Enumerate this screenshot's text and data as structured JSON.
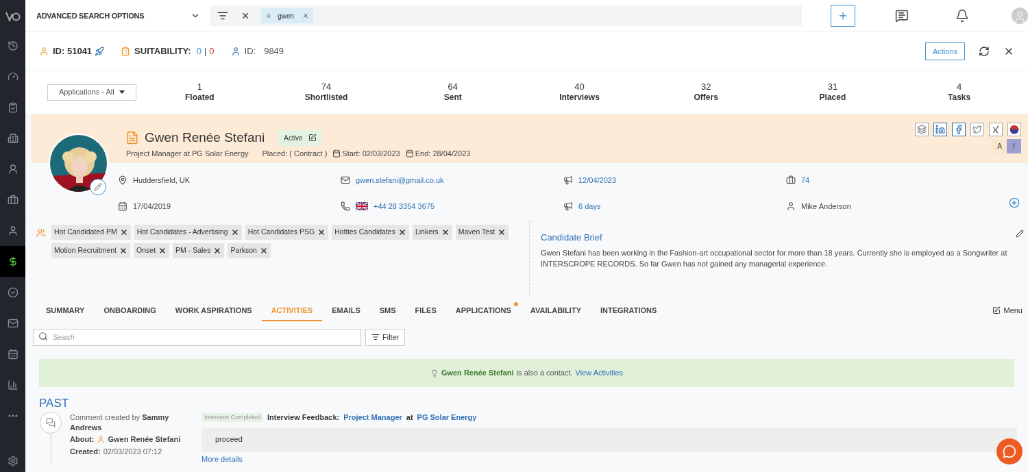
{
  "sidebar": {
    "items": [
      {
        "selected": false
      },
      {
        "selected": false
      },
      {
        "selected": false
      },
      {
        "selected": false
      },
      {
        "selected": false
      },
      {
        "selected": false
      },
      {
        "selected": false
      },
      {
        "selected": true
      },
      {
        "selected": false
      },
      {
        "selected": false
      },
      {
        "selected": false
      },
      {
        "selected": false
      },
      {
        "selected": false
      }
    ]
  },
  "topbar": {
    "search_options": "ADVANCED SEARCH OPTIONS",
    "chip": "gwen"
  },
  "header": {
    "id_label": "ID: 51041",
    "suitability_label": "SUITABILITY:",
    "suitability_good": "0",
    "separator": "|",
    "suitability_bad": "0",
    "contact_id_label": "ID:",
    "contact_id": "9849",
    "actions": "Actions"
  },
  "applications_filter": "Applications - All",
  "stats": [
    {
      "value": "1",
      "label": "Floated"
    },
    {
      "value": "74",
      "label": "Shortlisted"
    },
    {
      "value": "64",
      "label": "Sent"
    },
    {
      "value": "40",
      "label": "Interviews"
    },
    {
      "value": "32",
      "label": "Offers"
    },
    {
      "value": "31",
      "label": "Placed"
    },
    {
      "value": "4",
      "label": "Tasks"
    }
  ],
  "profile": {
    "name": "Gwen Renée Stefani",
    "status": "Active",
    "title": "Project Manager at PG Solar Energy",
    "placement": "Placed: ( Contract )",
    "start": "Start: 02/03/2023",
    "end": "End: 28/04/2023",
    "toggles": [
      {
        "label": "A",
        "selected": false
      },
      {
        "label": "I",
        "selected": true
      }
    ]
  },
  "details": [
    {
      "kind": "location",
      "text": "Huddersfield, UK",
      "link": false
    },
    {
      "kind": "email",
      "text": "gwen.stefani@gmail.co.uk",
      "link": true
    },
    {
      "kind": "megaphone",
      "text": "12/04/2023",
      "link": true
    },
    {
      "kind": "briefcase",
      "text": "74",
      "link": true
    },
    {
      "kind": "calendar",
      "text": "17/04/2019",
      "link": false
    },
    {
      "kind": "phone",
      "text": "+44 28 3354 3675",
      "link": true
    },
    {
      "kind": "megaphone",
      "text": "6 days",
      "link": true
    },
    {
      "kind": "person",
      "text": "Mike Anderson",
      "link": false
    }
  ],
  "tags": [
    "Hot Candidated PM",
    "Hot Candidates - Advertising",
    "Hot Candidates PSG",
    "Hotties Candidates",
    "Linkers",
    "Maven Test",
    "Motion Recruitment",
    "Onset",
    "PM - Sales",
    "Parkson"
  ],
  "brief": {
    "title": "Candidate Brief",
    "text": "Gwen Stefani has been working in the Fashion-art occupational sector for more than 18 years. Currently she is employed as a Songwriter at INTERSCROPE RECORDS. So far Gwen has not gained any managerial experience."
  },
  "tabs": [
    {
      "label": "SUMMARY",
      "selected": false,
      "dot": false
    },
    {
      "label": "ONBOARDING",
      "selected": false,
      "dot": false
    },
    {
      "label": "WORK ASPIRATIONS",
      "selected": false,
      "dot": false
    },
    {
      "label": "ACTIVITIES",
      "selected": true,
      "dot": false
    },
    {
      "label": "EMAILS",
      "selected": false,
      "dot": false
    },
    {
      "label": "SMS",
      "selected": false,
      "dot": false
    },
    {
      "label": "FILES",
      "selected": false,
      "dot": false
    },
    {
      "label": "APPLICATIONS",
      "selected": false,
      "dot": true
    },
    {
      "label": "AVAILABILITY",
      "selected": false,
      "dot": false
    },
    {
      "label": "INTEGRATIONS",
      "selected": false,
      "dot": false
    }
  ],
  "menu": "Menu",
  "search": {
    "placeholder": "Search",
    "filter": "Filter"
  },
  "banner": {
    "name": "Gwen Renée Stefani",
    "text": "is also a contact.",
    "link": "View Activities"
  },
  "timeline": {
    "heading": "PAST",
    "entries": [
      {
        "created_by_label": "Comment created by",
        "created_by": "Sammy Andrews",
        "about_label": "About:",
        "about": "Gwen Renée Stefani",
        "created_label": "Created:",
        "created": "02/03/2023 07:12",
        "status": "Interview Completed",
        "subject_label": "Interview Feedback:",
        "role": "Project Manager",
        "at": "at",
        "company": "PG Solar Energy",
        "body": "proceed",
        "more": "More details"
      }
    ]
  }
}
